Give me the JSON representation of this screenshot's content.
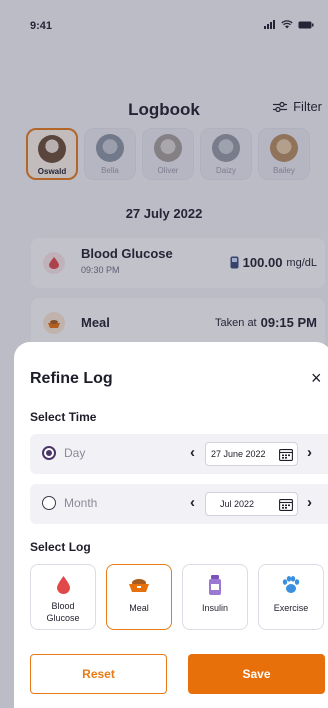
{
  "status_bar": {
    "time": "9:41"
  },
  "header": {
    "title": "Logbook",
    "filter_label": "Filter"
  },
  "pets": [
    {
      "name": "Oswald",
      "color": "#8a6a4a",
      "active": true
    },
    {
      "name": "Bella",
      "color": "#9aa4b0",
      "active": false
    },
    {
      "name": "Oliver",
      "color": "#b8b4ae",
      "active": false
    },
    {
      "name": "Daizy",
      "color": "#a8adb5",
      "active": false
    },
    {
      "name": "Bailey",
      "color": "#c9a06a",
      "active": false
    }
  ],
  "date_heading": "27 July 2022",
  "logs": [
    {
      "title": "Blood Glucose",
      "time": "09:30 PM",
      "value": "100.00",
      "unit": "mg/dL"
    },
    {
      "title": "Meal",
      "prefix": "Taken at",
      "value": "09:15 PM"
    }
  ],
  "sheet": {
    "title": "Refine Log",
    "close_symbol": "×",
    "select_time_label": "Select Time",
    "day_option": {
      "label": "Day",
      "value": "27 June 2022",
      "checked": true
    },
    "month_option": {
      "label": "Month",
      "value": "Jul 2022",
      "checked": false
    },
    "select_log_label": "Select Log",
    "categories": [
      {
        "label_line1": "Blood",
        "label_line2": "Glucose",
        "icon": "blood-drop-icon",
        "active": false
      },
      {
        "label_line1": "Meal",
        "label_line2": "",
        "icon": "food-bowl-icon",
        "active": true
      },
      {
        "label_line1": "Insulin",
        "label_line2": "",
        "icon": "insulin-vial-icon",
        "active": false
      },
      {
        "label_line1": "Exercise",
        "label_line2": "",
        "icon": "paw-icon",
        "active": false
      }
    ],
    "reset_label": "Reset",
    "save_label": "Save"
  },
  "colors": {
    "accent": "#e8700a",
    "radio": "#4a3568",
    "drop": "#e0484a",
    "paw": "#3a8fe0",
    "vial": "#7a52b8"
  }
}
